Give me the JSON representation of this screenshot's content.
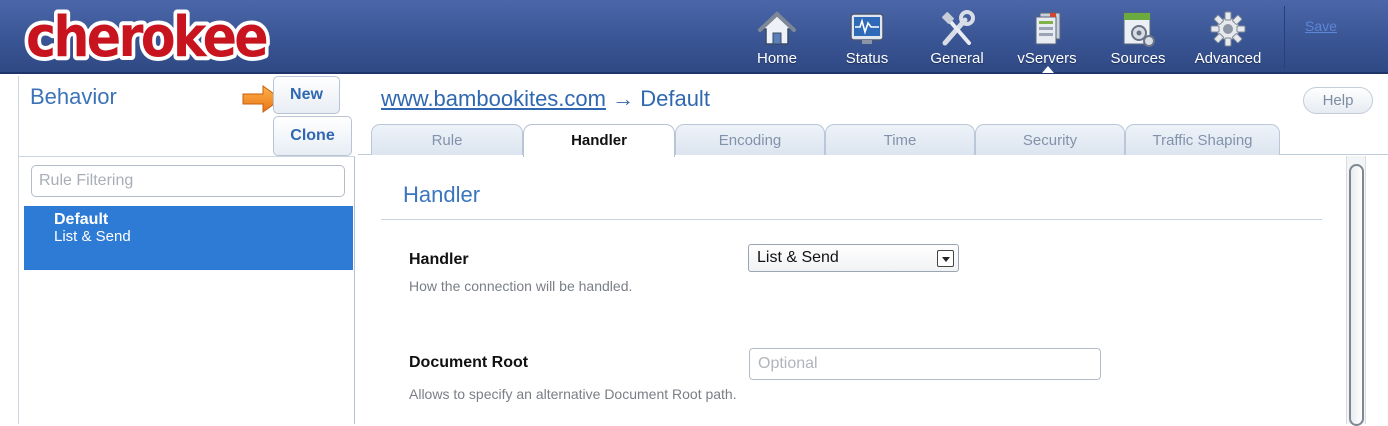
{
  "app": {
    "logo_text": "cherokee",
    "save_label": "Save"
  },
  "nav": [
    {
      "label": "Home",
      "icon": "home-icon"
    },
    {
      "label": "Status",
      "icon": "status-monitor-icon"
    },
    {
      "label": "General",
      "icon": "tools-icon"
    },
    {
      "label": "vServers",
      "icon": "vservers-icon"
    },
    {
      "label": "Sources",
      "icon": "sources-icon"
    },
    {
      "label": "Advanced",
      "icon": "gear-icon"
    }
  ],
  "sidebar": {
    "title": "Behavior",
    "new_label": "New",
    "clone_label": "Clone",
    "filter_placeholder": "Rule Filtering",
    "rules": [
      {
        "name": "Default",
        "handler": "List & Send"
      }
    ]
  },
  "breadcrumb": {
    "vserver": "www.bambookites.com",
    "separator": " → ",
    "rule": "Default"
  },
  "help_label": "Help",
  "tabs": [
    "Rule",
    "Handler",
    "Encoding",
    "Time",
    "Security",
    "Traffic Shaping"
  ],
  "active_tab": "Handler",
  "section": {
    "title": "Handler",
    "fields": [
      {
        "label": "Handler",
        "help": "How the connection will be handled.",
        "value": "List & Send"
      },
      {
        "label": "Document Root",
        "help": "Allows to specify an alternative Document Root path.",
        "placeholder": "Optional"
      }
    ]
  },
  "colors": {
    "topbar": "#3a5594",
    "accent": "#2d7bd5",
    "link": "#2f68b0",
    "logo": "#c8141e"
  }
}
